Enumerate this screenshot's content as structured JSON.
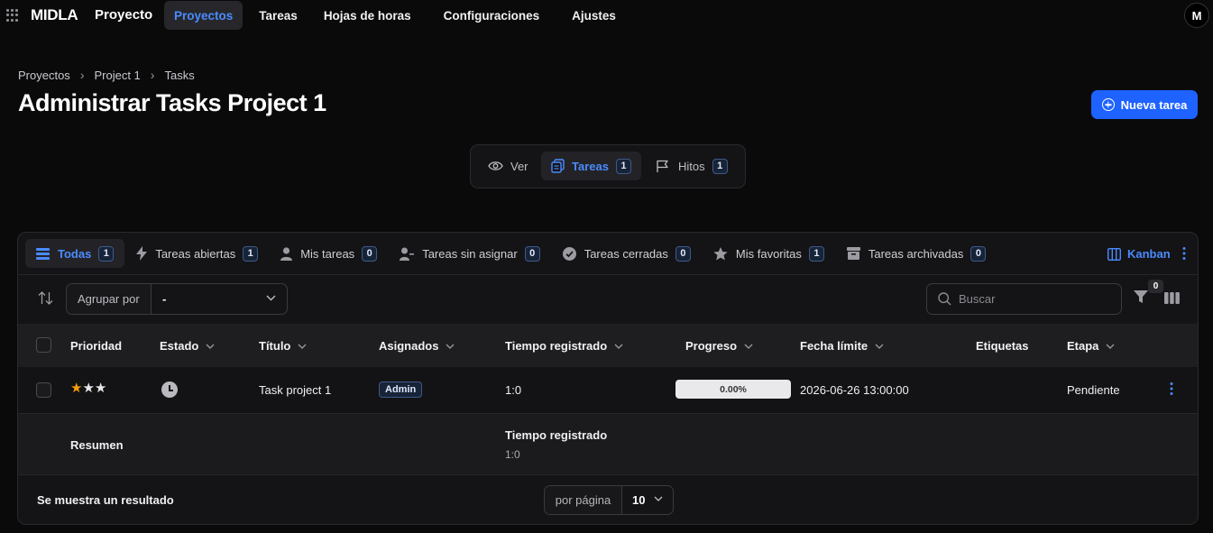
{
  "nav": {
    "brand": "MIDLA",
    "context": "Proyecto",
    "links": [
      "Proyectos",
      "Tareas",
      "Hojas de horas",
      "Configuraciones",
      "Ajustes"
    ],
    "avatar_initial": "M"
  },
  "breadcrumb": [
    "Proyectos",
    "Project 1",
    "Tasks"
  ],
  "page_title": "Administrar Tasks Project 1",
  "new_button": "Nueva tarea",
  "subtabs": [
    {
      "label": "Ver",
      "count": ""
    },
    {
      "label": "Tareas",
      "count": "1"
    },
    {
      "label": "Hitos",
      "count": "1"
    }
  ],
  "filter_tabs": [
    {
      "label": "Todas",
      "count": "1"
    },
    {
      "label": "Tareas abiertas",
      "count": "1"
    },
    {
      "label": "Mis tareas",
      "count": "0"
    },
    {
      "label": "Tareas sin asignar",
      "count": "0"
    },
    {
      "label": "Tareas cerradas",
      "count": "0"
    },
    {
      "label": "Mis favoritas",
      "count": "1"
    },
    {
      "label": "Tareas archivadas",
      "count": "0"
    }
  ],
  "kanban_label": "Kanban",
  "group_by": {
    "label": "Agrupar por",
    "value": "-"
  },
  "search_placeholder": "Buscar",
  "filter_count": "0",
  "columns": [
    "Prioridad",
    "Estado",
    "Título",
    "Asignados",
    "Tiempo registrado",
    "Progreso",
    "Fecha límite",
    "Etiquetas",
    "Etapa"
  ],
  "rows": [
    {
      "priority_stars": 1,
      "priority_max": 3,
      "status_icon": "clock-icon",
      "title": "Task project 1",
      "assignee": "Admin",
      "time": "1:0",
      "progress": "0.00%",
      "due": "2026-06-26 13:00:00",
      "tags": "",
      "stage": "Pendiente"
    }
  ],
  "summary": {
    "label": "Resumen",
    "time_heading": "Tiempo registrado",
    "time_value": "1:0"
  },
  "footer": {
    "result_text": "Se muestra un resultado",
    "per_page_label": "por página",
    "per_page_value": "10"
  },
  "colors": {
    "accent": "#4a8bff",
    "primary_button": "#1e63ff",
    "star": "#f59e0b"
  }
}
